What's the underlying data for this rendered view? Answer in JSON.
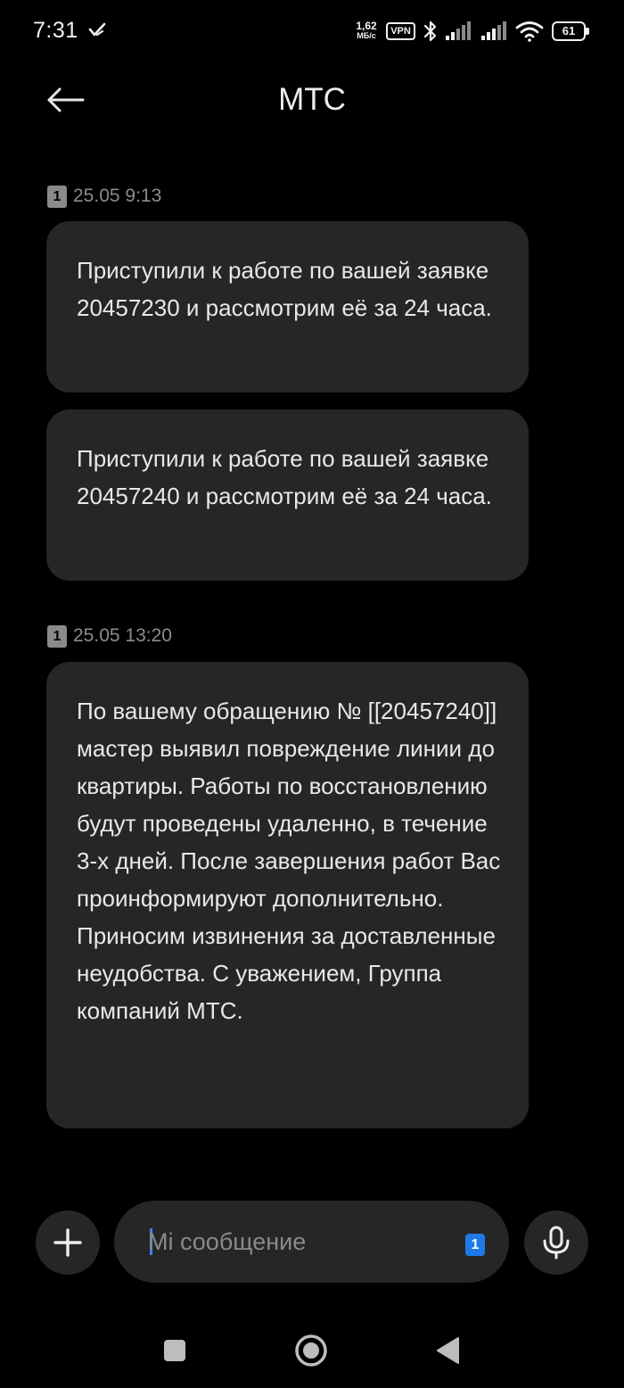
{
  "status_bar": {
    "time": "7:31",
    "net_speed_value": "1,62",
    "net_speed_unit": "МБ/с",
    "vpn_label": "VPN",
    "battery_level": "61"
  },
  "header": {
    "title": "МТС"
  },
  "messages": [
    {
      "sim": "1",
      "timestamp": "25.05 9:13",
      "texts": [
        "Приступили к работе по вашей заявке 20457230 и рассмотрим её за 24 часа.",
        "Приступили к работе по вашей заявке 20457240 и рассмотрим её за 24 часа."
      ]
    },
    {
      "sim": "1",
      "timestamp": "25.05 13:20",
      "texts": [
        "По вашему обращению № [[20457240]] мастер выявил повреждение линии до квартиры. Работы по восстановлению будут проведены удаленно, в течение 3-х дней. После завершения работ Вас проинформируют дополнительно. Приносим извинения за доставленные неудобства. С уважением, Группа компаний МТС."
      ]
    }
  ],
  "composer": {
    "placeholder": "Mi сообщение",
    "value": "",
    "sim_label": "1"
  },
  "colors": {
    "background": "#000000",
    "bubble": "#262626",
    "accent": "#1e7ae6",
    "timestamp": "#8c8c8c"
  },
  "icons": {
    "back": "arrow-left-icon",
    "add": "plus-icon",
    "mic": "microphone-icon",
    "nav_recents": "square-icon",
    "nav_home": "circle-icon",
    "nav_back": "triangle-back-icon"
  }
}
